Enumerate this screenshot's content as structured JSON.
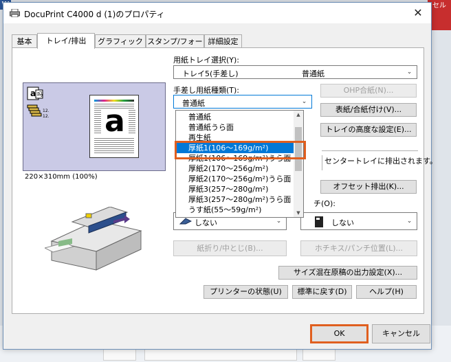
{
  "background": {
    "word_letter": "W",
    "side_tab": "セル"
  },
  "window": {
    "title": "DocuPrint C4000 d (1)のプロパティ",
    "close_glyph": "✕"
  },
  "tabs": [
    "基本",
    "トレイ/排出",
    "グラフィックス",
    "スタンプ/フォーム",
    "詳細設定"
  ],
  "active_tab": "トレイ/排出",
  "preview": {
    "caption": "220×310mm (100%)",
    "page_letter": "a"
  },
  "paper_tray": {
    "label": "用紙トレイ選択(Y):",
    "value": "トレイ5(手差し)",
    "value_type": "普通紙"
  },
  "bypass_type": {
    "label": "手差し用紙種類(T):",
    "value": "普通紙",
    "options": [
      "普通紙",
      "普通紙うら面",
      "再生紙",
      "厚紙1(106～169g/m²)",
      "厚紙1(106～169g/m²)うら面",
      "厚紙2(170～256g/m²)",
      "厚紙2(170～256g/m²)うら面",
      "厚紙3(257～280g/m²)",
      "厚紙3(257～280g/m²)うら面",
      "うす紙(55～59g/m²)"
    ],
    "selected_index": 3
  },
  "buttons": {
    "ohp": "OHP合紙(N)...",
    "cover": "表紙/合紙付け(V)...",
    "tray_advanced": "トレイの高度な設定(E)...",
    "offset": "オフセット排出(K)...",
    "fold": "紙折り/中とじ(B)...",
    "staple_pos": "ホチキス/パンチ位置(L)...",
    "mixed_size": "サイズ混在原稿の出力設定(X)...",
    "printer_status": "プリンターの状態(U)",
    "defaults": "標準に戻す(D)",
    "help": "ヘルプ(H)",
    "ok": "OK",
    "cancel": "キャンセル"
  },
  "output_info": "センタートレイに排出されます。",
  "staple": {
    "label_suffix": "チ(O):",
    "value": "しない"
  },
  "fold_select": {
    "value": "しない"
  }
}
